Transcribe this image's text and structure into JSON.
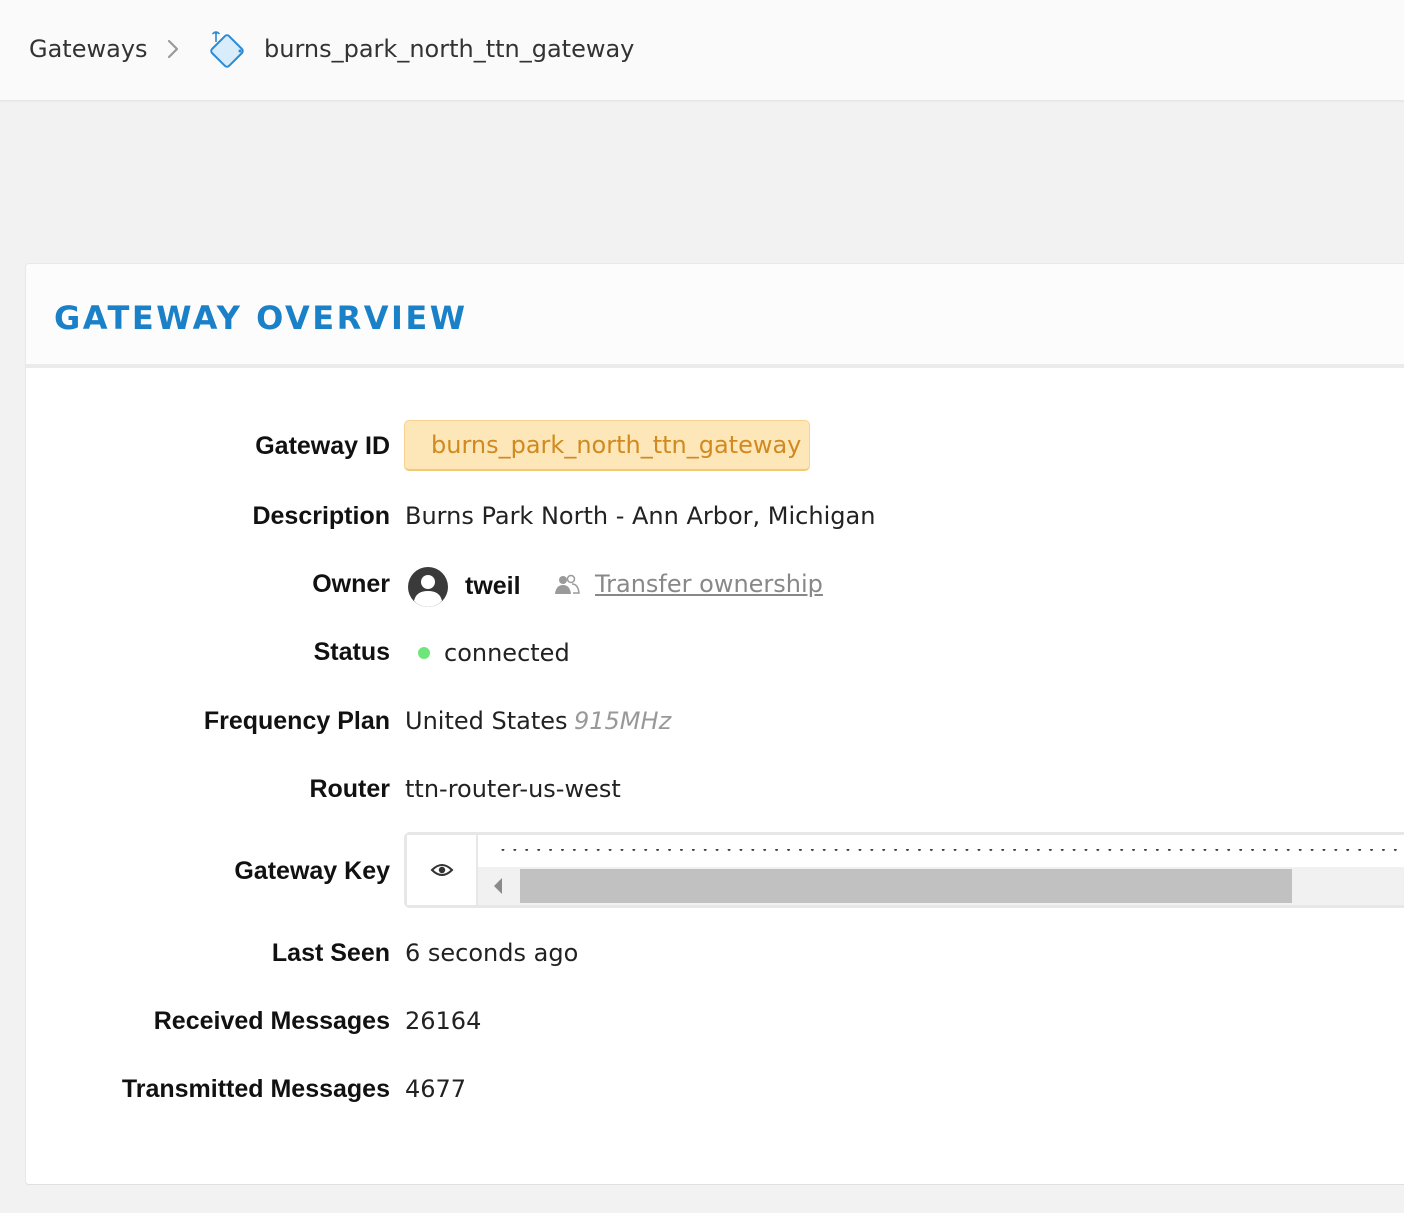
{
  "breadcrumb": {
    "root": "Gateways",
    "current": "burns_park_north_ttn_gateway"
  },
  "section": {
    "title": "GATEWAY OVERVIEW"
  },
  "fields": {
    "gateway_id": {
      "label": "Gateway ID",
      "value": "burns_park_north_ttn_gateway"
    },
    "description": {
      "label": "Description",
      "value": "Burns Park North - Ann Arbor, Michigan"
    },
    "owner": {
      "label": "Owner",
      "name": "tweil",
      "transfer_label": "Transfer ownership"
    },
    "status": {
      "label": "Status",
      "value": "connected",
      "color": "#6ee77a"
    },
    "frequency_plan": {
      "label": "Frequency Plan",
      "value": "United States",
      "sub": "915MHz"
    },
    "router": {
      "label": "Router",
      "value": "ttn-router-us-west"
    },
    "gateway_key": {
      "label": "Gateway Key",
      "masked": "••••••••••••••••••••••••••••••••••••••••••••••••••••••••••••••••••••••••••••••"
    },
    "last_seen": {
      "label": "Last Seen",
      "value": "6 seconds ago"
    },
    "received": {
      "label": "Received Messages",
      "value": "26164"
    },
    "transmitted": {
      "label": "Transmitted Messages",
      "value": "4677"
    }
  },
  "colors": {
    "accent": "#1a81c8",
    "id_text": "#d08a1f",
    "id_bg": "#fde6b8"
  },
  "icons": {
    "breadcrumb_separator": "chevron-right-icon",
    "gateway": "gateway-icon",
    "avatar": "user-avatar-icon",
    "transfer": "users-icon",
    "reveal": "eye-icon"
  }
}
